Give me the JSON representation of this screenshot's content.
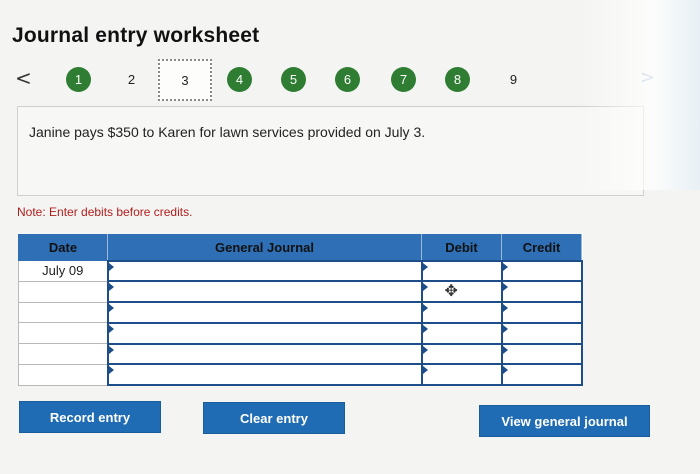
{
  "title": "Journal entry worksheet",
  "nav": {
    "prev_symbol": "<",
    "next_symbol": ">",
    "steps": [
      {
        "label": "1",
        "state": "done"
      },
      {
        "label": "2",
        "state": "plain"
      },
      {
        "label": "3",
        "state": "current"
      },
      {
        "label": "4",
        "state": "done"
      },
      {
        "label": "5",
        "state": "done"
      },
      {
        "label": "6",
        "state": "done"
      },
      {
        "label": "7",
        "state": "done"
      },
      {
        "label": "8",
        "state": "done"
      },
      {
        "label": "9",
        "state": "plain"
      }
    ]
  },
  "question": "Janine pays $350 to Karen for lawn services provided on July 3.",
  "note": "Note: Enter debits before credits.",
  "table": {
    "headers": {
      "date": "Date",
      "journal": "General Journal",
      "debit": "Debit",
      "credit": "Credit"
    },
    "rows": [
      {
        "date": "July 09",
        "account": "",
        "debit": "",
        "credit": ""
      },
      {
        "date": "",
        "account": "",
        "debit": "",
        "credit": ""
      },
      {
        "date": "",
        "account": "",
        "debit": "",
        "credit": ""
      },
      {
        "date": "",
        "account": "",
        "debit": "",
        "credit": ""
      },
      {
        "date": "",
        "account": "",
        "debit": "",
        "credit": ""
      },
      {
        "date": "",
        "account": "",
        "debit": "",
        "credit": ""
      }
    ]
  },
  "buttons": {
    "record": "Record entry",
    "clear": "Clear entry",
    "view": "View general journal"
  },
  "colors": {
    "step_done": "#2e7d32",
    "header_blue": "#2f6fb6",
    "button_blue": "#1f6cb5",
    "note_red": "#b01e1e"
  }
}
